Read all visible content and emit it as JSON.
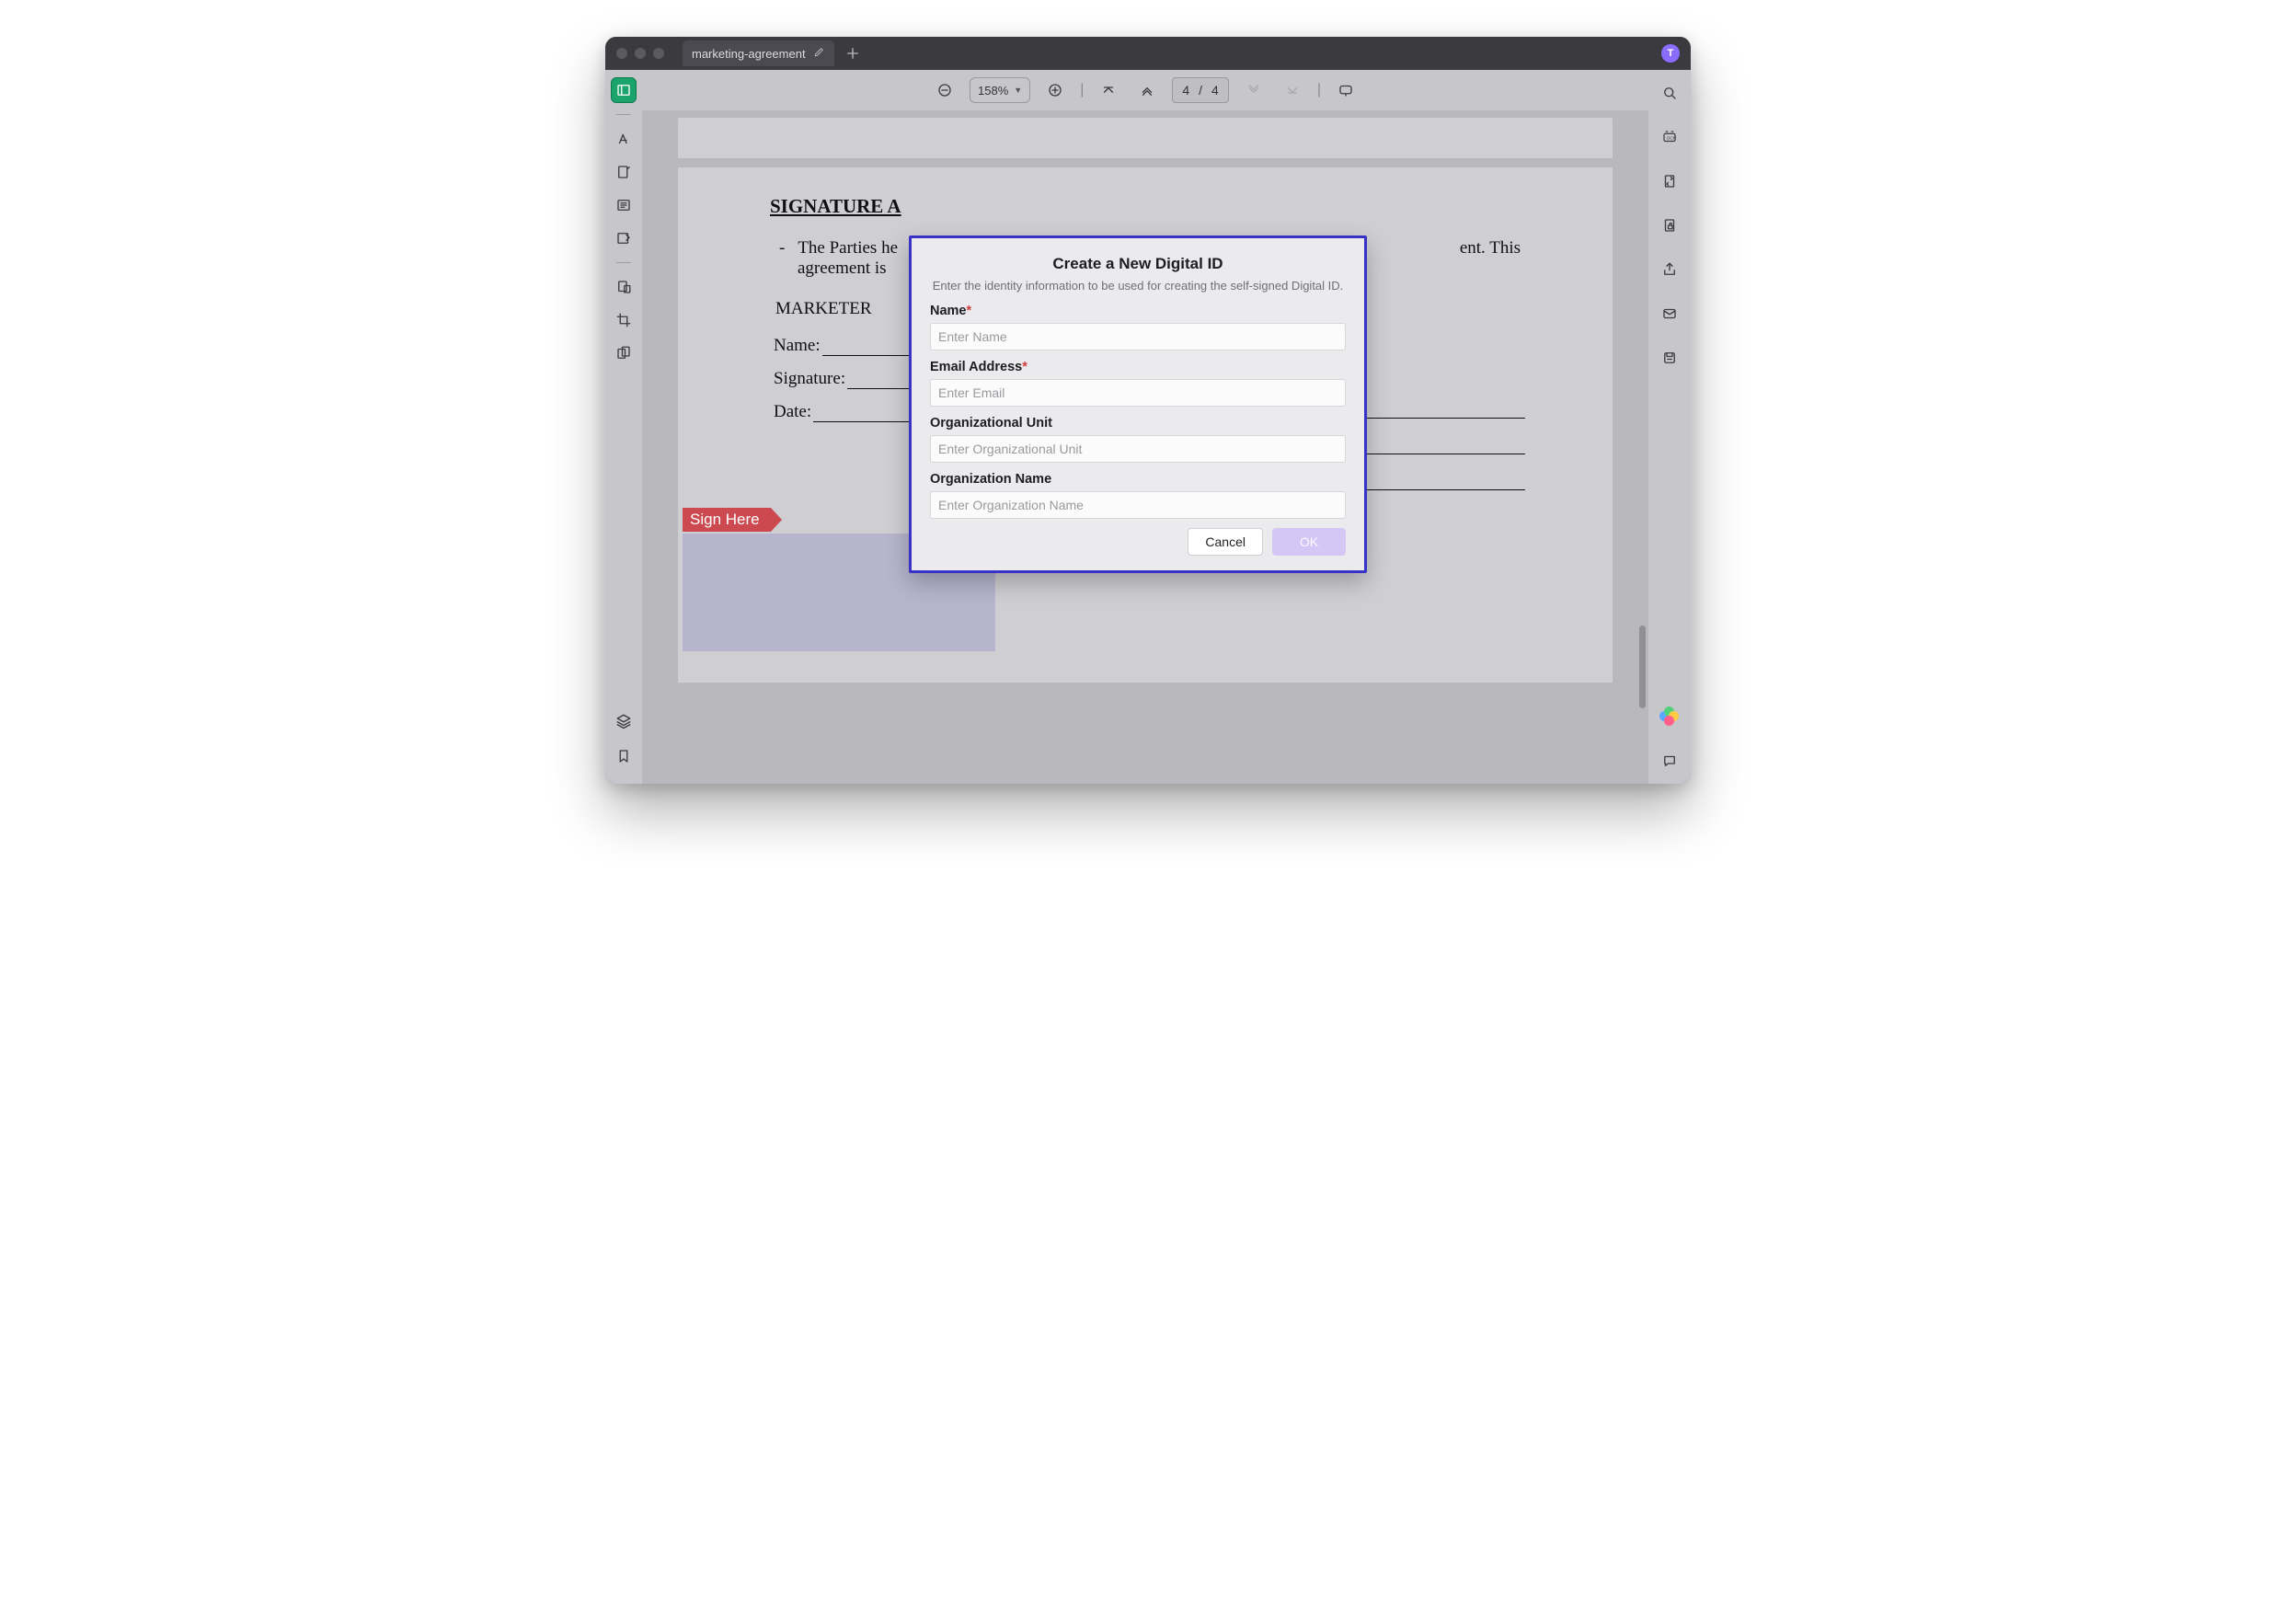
{
  "titlebar": {
    "tab_label": "marketing-agreement",
    "avatar_initial": "T"
  },
  "toolbar": {
    "zoom": "158%",
    "page_current": "4",
    "page_sep": "/",
    "page_total": "4"
  },
  "document": {
    "heading_prefix": "SIGNATURE A",
    "para_dash": "-",
    "para_line1": "The Parties he",
    "para_line2": "agreement is",
    "para_right_tail": "ent. This",
    "role_label": "MARKETER",
    "name_label": "Name:",
    "signature_label": "Signature:",
    "date_label": "Date:",
    "sign_here": "Sign Here"
  },
  "modal": {
    "title": "Create a New Digital ID",
    "subtitle": "Enter the identity information to be used for creating the self-signed Digital ID.",
    "fields": {
      "name": {
        "label": "Name",
        "required_mark": "*",
        "placeholder": "Enter Name"
      },
      "email": {
        "label": "Email Address",
        "required_mark": "*",
        "placeholder": "Enter Email"
      },
      "org_unit": {
        "label": "Organizational Unit",
        "placeholder": "Enter Organizational Unit"
      },
      "org_name": {
        "label": "Organization Name",
        "placeholder": "Enter Organization Name"
      }
    },
    "cancel": "Cancel",
    "ok": "OK"
  }
}
